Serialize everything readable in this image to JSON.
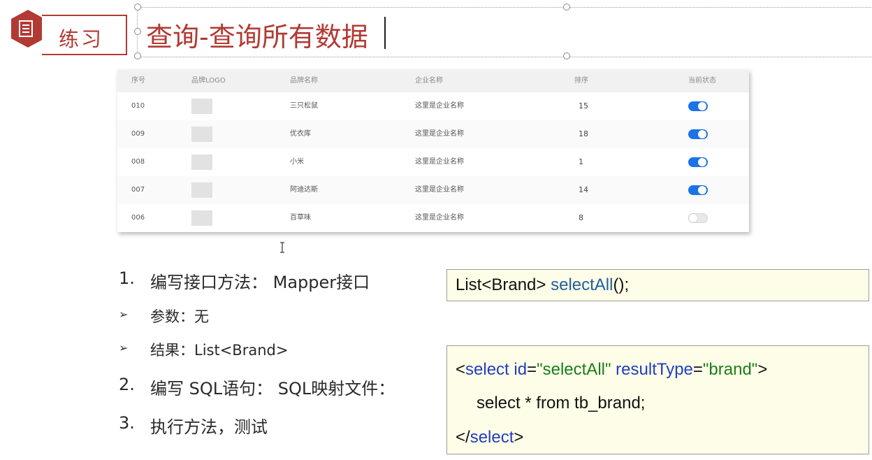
{
  "header": {
    "badge_label": "练习",
    "title": "查询-查询所有数据",
    "badge_color": "#b23a34"
  },
  "table": {
    "columns": [
      "序号",
      "品牌LOGO",
      "品牌名称",
      "企业名称",
      "排序",
      "当前状态"
    ],
    "rows": [
      {
        "id": "010",
        "brand": "三只松鼠",
        "company": "这里是企业名称",
        "sort": "15",
        "status": "on"
      },
      {
        "id": "009",
        "brand": "优衣库",
        "company": "这里是企业名称",
        "sort": "18",
        "status": "on"
      },
      {
        "id": "008",
        "brand": "小米",
        "company": "这里是企业名称",
        "sort": "1",
        "status": "on"
      },
      {
        "id": "007",
        "brand": "阿迪达斯",
        "company": "这里是企业名称",
        "sort": "14",
        "status": "on"
      },
      {
        "id": "006",
        "brand": "百草味",
        "company": "这里是企业名称",
        "sort": "8",
        "status": "off"
      }
    ],
    "toggle_on_color": "#1a73e8"
  },
  "steps": {
    "s1_num": "1.",
    "s1_text": "编写接口方法： Mapper接口",
    "s1_param": "参数：无",
    "s1_result": "结果：List<Brand>",
    "s2_num": "2.",
    "s2_text": "编写 SQL语句： SQL映射文件：",
    "s3_num": "3.",
    "s3_text": "执行方法，测试",
    "bullet_glyph": "➢"
  },
  "code": {
    "c1_type": "List<Brand> ",
    "c1_method": "selectAll",
    "c1_tail": "();",
    "c2_open_lt": "<",
    "c2_tag": "select",
    "c2_attr1": " id",
    "c2_eq1": "=",
    "c2_val1": "\"selectAll\"",
    "c2_attr2": " resultType",
    "c2_eq2": "=",
    "c2_val2": "\"brand\"",
    "c2_gt": ">",
    "c2_body": "select * from tb_brand;",
    "c2_close_lt": "</",
    "c2_close_tag": "select",
    "c2_close_gt": ">"
  }
}
